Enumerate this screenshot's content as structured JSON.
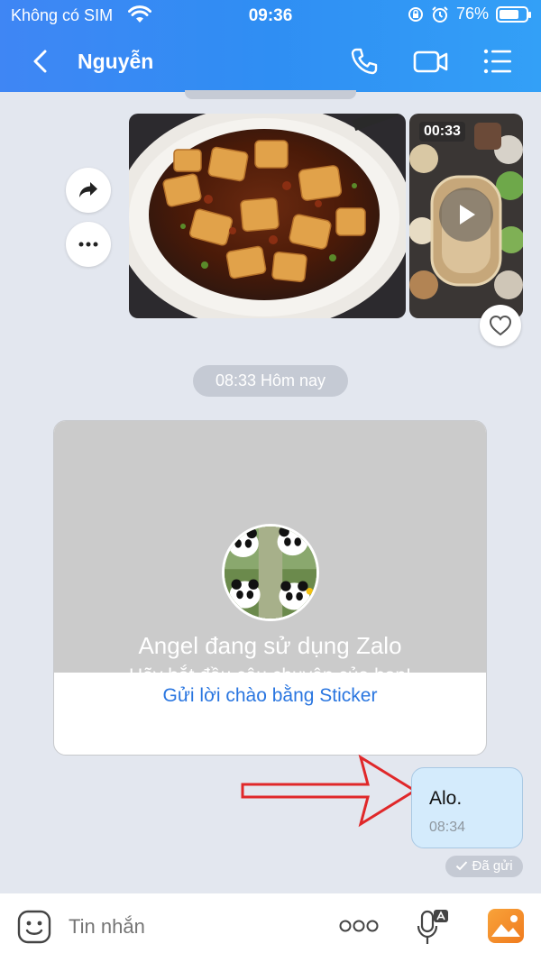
{
  "status": {
    "carrier": "Không có SIM",
    "time": "09:36",
    "battery_percent": "76%",
    "battery_level": 0.76
  },
  "header": {
    "title": "Nguyễn",
    "icons": [
      "back-icon",
      "phone-icon",
      "video-call-icon",
      "menu-list-icon"
    ]
  },
  "media": {
    "video_duration": "00:33"
  },
  "timestamp": "08:33 Hôm nay",
  "greeting_card": {
    "name_line": "Angel đang sử dụng Zalo",
    "sub_line": "Hãy bắt đầu câu chuyện của bạn!",
    "action": "Gửi lời chào bằng Sticker"
  },
  "my_message": {
    "text": "Alo.",
    "time": "08:34",
    "status": "Đã gửi"
  },
  "composer": {
    "placeholder": "Tin nhắn"
  },
  "colors": {
    "header_blue": "#3f86f4",
    "chat_bg": "#e3e7ef",
    "bubble_blue": "#d4ebfc",
    "link_blue": "#2a76e0",
    "arrow_red": "#e0282a"
  }
}
